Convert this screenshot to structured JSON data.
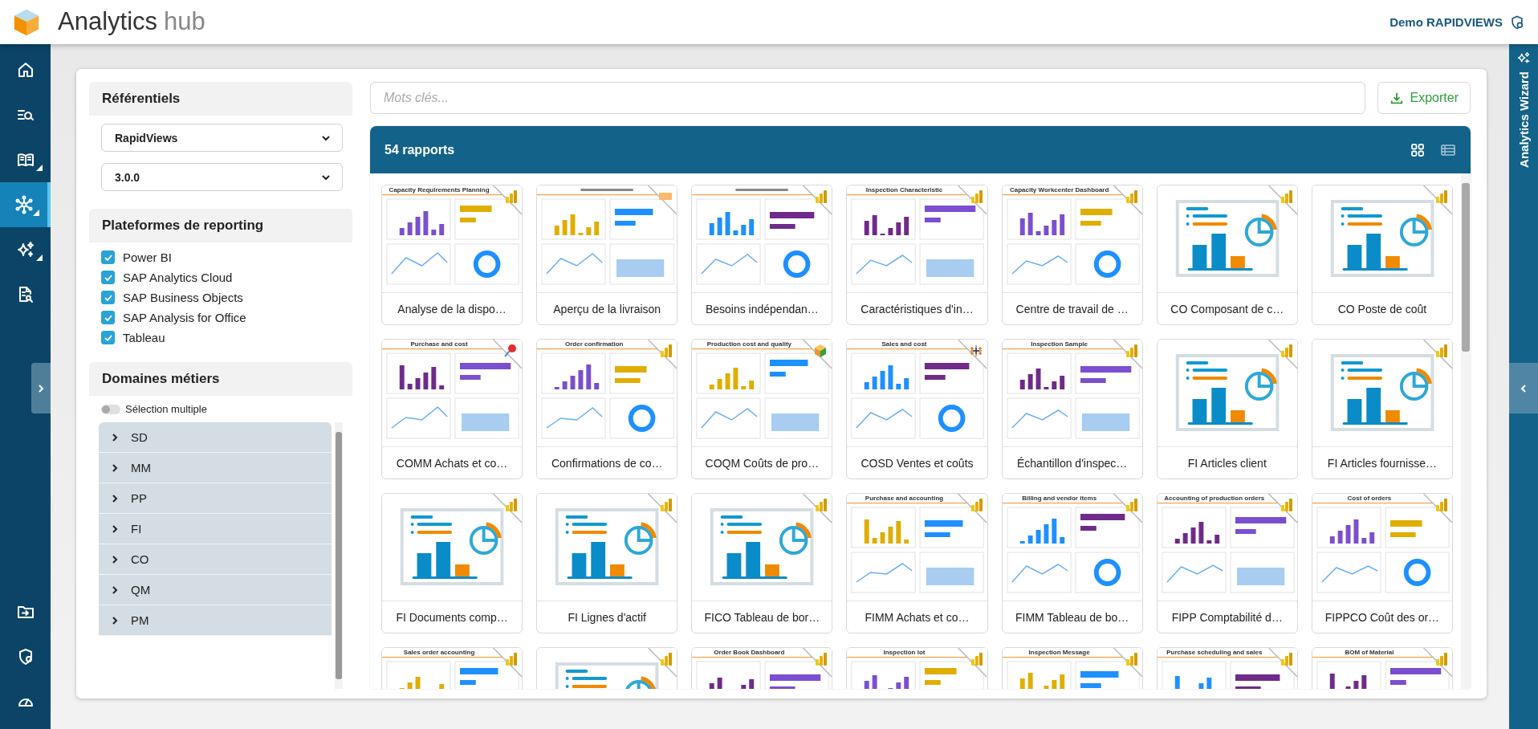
{
  "header": {
    "app_name": "Analytics",
    "app_suffix": "hub",
    "user": "Demo RAPIDVIEWS"
  },
  "nav": [
    {
      "selected": false,
      "submenu": false
    },
    {
      "selected": false,
      "submenu": false
    },
    {
      "selected": false,
      "submenu": true
    },
    {
      "selected": true,
      "submenu": true
    },
    {
      "selected": false,
      "submenu": true
    },
    {
      "selected": false,
      "submenu": false
    }
  ],
  "nav_bottom": [
    {
      "selected": false,
      "submenu": false
    },
    {
      "selected": false,
      "submenu": false
    },
    {
      "selected": false,
      "submenu": false
    }
  ],
  "filters": {
    "referentiels": {
      "title": "Référentiels",
      "selects": [
        "RapidViews",
        "3.0.0"
      ]
    },
    "platforms": {
      "title": "Plateformes de reporting",
      "items": [
        {
          "label": "Power BI",
          "checked": true
        },
        {
          "label": "SAP Analytics Cloud",
          "checked": true
        },
        {
          "label": "SAP Business Objects",
          "checked": true
        },
        {
          "label": "SAP Analysis for Office",
          "checked": true
        },
        {
          "label": "Tableau",
          "checked": true
        }
      ]
    },
    "domains": {
      "title": "Domaines métiers",
      "multi_select": {
        "label": "Sélection multiple",
        "on": false
      },
      "items": [
        {
          "label": "SD",
          "expanded": false
        },
        {
          "label": "MM",
          "expanded": false
        },
        {
          "label": "PP",
          "expanded": false
        },
        {
          "label": "FI",
          "expanded": false
        },
        {
          "label": "CO",
          "expanded": false
        },
        {
          "label": "QM",
          "expanded": false
        },
        {
          "label": "PM",
          "expanded": false
        }
      ]
    }
  },
  "search": {
    "placeholder": "Mots clés..."
  },
  "export_button": "Exporter",
  "results": {
    "count": "54 rapports",
    "views": [
      {
        "selected": true
      },
      {
        "selected": false
      }
    ]
  },
  "reports": [
    {
      "title": "Analyse de la dispo…",
      "kind": "dashboard",
      "heading": "Capacity Requirements Planning",
      "badge": {
        "kind": "power-bi"
      }
    },
    {
      "title": "Aperçu de la livraison",
      "kind": "dashboard",
      "badge": {
        "kind": "sap"
      }
    },
    {
      "title": "Besoins indépendan…",
      "kind": "dashboard",
      "badge": {
        "kind": "power-bi"
      }
    },
    {
      "title": "Caractéristiques d'in…",
      "kind": "dashboard",
      "heading": "Inspection Characteristic",
      "badge": {
        "kind": "power-bi"
      }
    },
    {
      "title": "Centre de travail de …",
      "kind": "dashboard",
      "heading": "Capacity Workcenter Dashboard",
      "badge": {
        "kind": "power-bi"
      }
    },
    {
      "title": "CO Composant de c…",
      "kind": "illustration",
      "badge": {
        "kind": "power-bi"
      }
    },
    {
      "title": "CO Poste de coût",
      "kind": "illustration",
      "badge": {
        "kind": "power-bi"
      }
    },
    {
      "title": "COMM Achats et co…",
      "kind": "dashboard",
      "heading": "Purchase and cost",
      "badge": {
        "kind": "pin"
      }
    },
    {
      "title": "Confirmations de co…",
      "kind": "dashboard",
      "heading": "Order confirmation",
      "badge": {
        "kind": "power-bi"
      }
    },
    {
      "title": "COQM Coûts de pro…",
      "kind": "dashboard",
      "heading": "Production cost and quality",
      "badge": {
        "kind": "cube"
      }
    },
    {
      "title": "COSD Ventes et coûts",
      "kind": "dashboard",
      "heading": "Sales and cost",
      "badge": {
        "kind": "tableau"
      }
    },
    {
      "title": "Échantillon d'inspec…",
      "kind": "dashboard",
      "heading": "Inspection Sample",
      "badge": {
        "kind": "power-bi"
      }
    },
    {
      "title": "FI Articles client",
      "kind": "illustration",
      "badge": {
        "kind": "power-bi"
      }
    },
    {
      "title": "FI Articles fournisse…",
      "kind": "illustration",
      "badge": {
        "kind": "power-bi"
      }
    },
    {
      "title": "FI Documents comp…",
      "kind": "illustration",
      "badge": {
        "kind": "power-bi"
      }
    },
    {
      "title": "FI Lignes d'actif",
      "kind": "illustration",
      "badge": {
        "kind": "power-bi"
      }
    },
    {
      "title": "FICO Tableau de bor…",
      "kind": "illustration",
      "badge": {
        "kind": "power-bi"
      }
    },
    {
      "title": "FIMM Achats et co…",
      "kind": "dashboard",
      "heading": "Purchase and accounting",
      "badge": {
        "kind": "power-bi"
      }
    },
    {
      "title": "FIMM Tableau de bo…",
      "kind": "dashboard",
      "heading": "Billing and vendor items",
      "badge": {
        "kind": "power-bi"
      }
    },
    {
      "title": "FIPP Comptabilité d…",
      "kind": "dashboard",
      "heading": "Accounting of production orders",
      "badge": {
        "kind": "power-bi"
      }
    },
    {
      "title": "FIPPCO Coût des or…",
      "kind": "dashboard",
      "heading": "Cost of orders",
      "badge": {
        "kind": "power-bi"
      }
    },
    {
      "kind": "dashboard",
      "heading": "Sales order accounting",
      "badge": {
        "kind": "power-bi"
      }
    },
    {
      "kind": "illustration",
      "badge": {
        "kind": "power-bi"
      }
    },
    {
      "kind": "dashboard",
      "heading": "Order Book Dashboard",
      "badge": {
        "kind": "power-bi"
      }
    },
    {
      "kind": "dashboard",
      "heading": "Inspection lot",
      "badge": {
        "kind": "power-bi"
      }
    },
    {
      "kind": "dashboard",
      "heading": "Inspection Message",
      "badge": {
        "kind": "power-bi"
      }
    },
    {
      "kind": "dashboard",
      "heading": "Purchase scheduling and sales",
      "badge": {
        "kind": "power-bi"
      }
    },
    {
      "kind": "dashboard",
      "heading": "BOM of Material",
      "badge": {
        "kind": "power-bi"
      }
    }
  ],
  "wizard": {
    "label": "Analytics Wizard"
  }
}
